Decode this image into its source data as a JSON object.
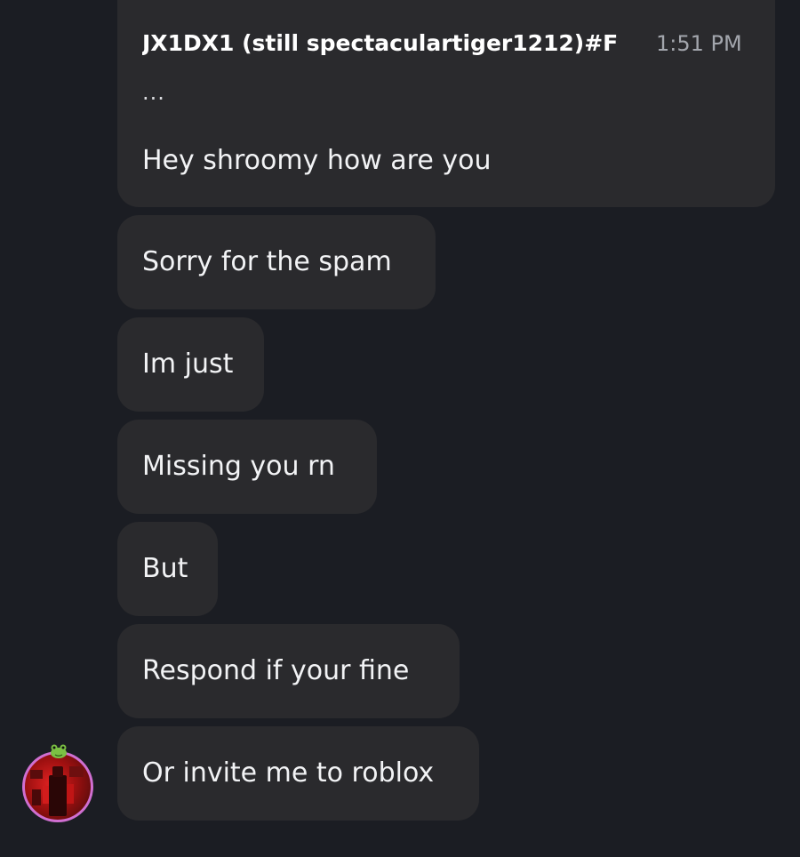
{
  "header": {
    "author": "JX1DX1 (still spectaculartiger1212)#F",
    "timestamp": "1:51 PM"
  },
  "messages": [
    {
      "text": "Hey shroomy how are you"
    },
    {
      "text": "Sorry for the spam"
    },
    {
      "text": "Im just"
    },
    {
      "text": "Missing you rn"
    },
    {
      "text": "But"
    },
    {
      "text": "Respond if your fine"
    },
    {
      "text": "Or invite me to roblox"
    }
  ],
  "ellipsis": "...",
  "avatar": {
    "icon": "user-avatar",
    "ring_color": "#d06fd1"
  },
  "colors": {
    "background": "#1b1d23",
    "bubble": "#2a2a2d",
    "text": "#f2f3f5",
    "timestamp": "#a3a6ad"
  }
}
